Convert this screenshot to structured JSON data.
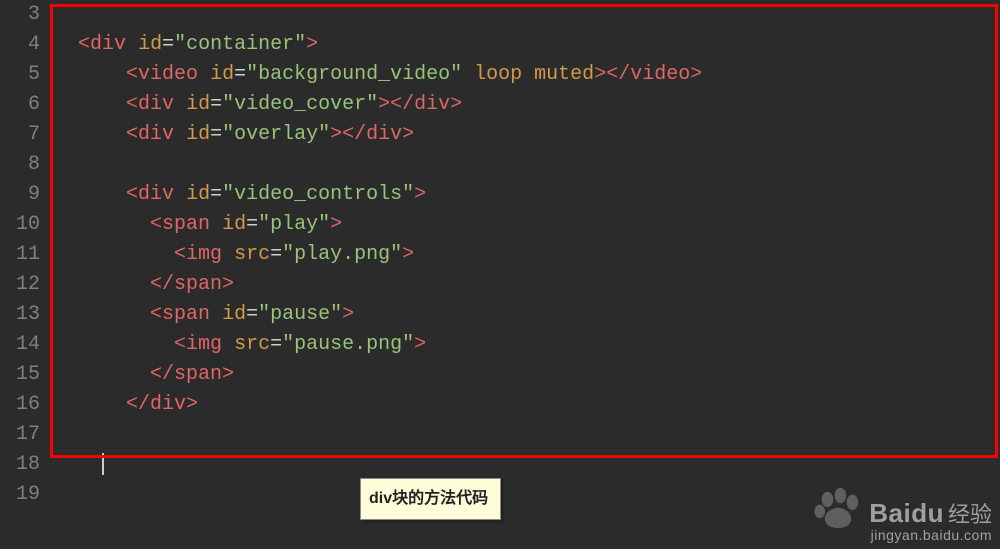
{
  "lines": {
    "numbers": [
      "3",
      "4",
      "5",
      "6",
      "7",
      "8",
      "9",
      "10",
      "11",
      "12",
      "13",
      "14",
      "15",
      "16",
      "17",
      "18",
      "19"
    ]
  },
  "code": {
    "l4": {
      "tag": "div",
      "attr": "id",
      "val": "\"container\""
    },
    "l5": {
      "tag": "video",
      "attr": "id",
      "val": "\"background_video\"",
      "extra": "loop muted",
      "close": "video"
    },
    "l6": {
      "tag": "div",
      "attr": "id",
      "val": "\"video_cover\"",
      "close": "div"
    },
    "l7": {
      "tag": "div",
      "attr": "id",
      "val": "\"overlay\"",
      "close": "div"
    },
    "l9": {
      "tag": "div",
      "attr": "id",
      "val": "\"video_controls\""
    },
    "l10": {
      "tag": "span",
      "attr": "id",
      "val": "\"play\""
    },
    "l11": {
      "tag": "img",
      "attr": "src",
      "val": "\"play.png\""
    },
    "l12": {
      "close": "span"
    },
    "l13": {
      "tag": "span",
      "attr": "id",
      "val": "\"pause\""
    },
    "l14": {
      "tag": "img",
      "attr": "src",
      "val": "\"pause.png\""
    },
    "l15": {
      "close": "span"
    },
    "l16": {
      "close": "div"
    }
  },
  "tooltip": {
    "text": "div块的方法代码"
  },
  "watermark": {
    "brand_en": "Baidu",
    "brand_cn": "经验",
    "url": "jingyan.baidu.com"
  }
}
